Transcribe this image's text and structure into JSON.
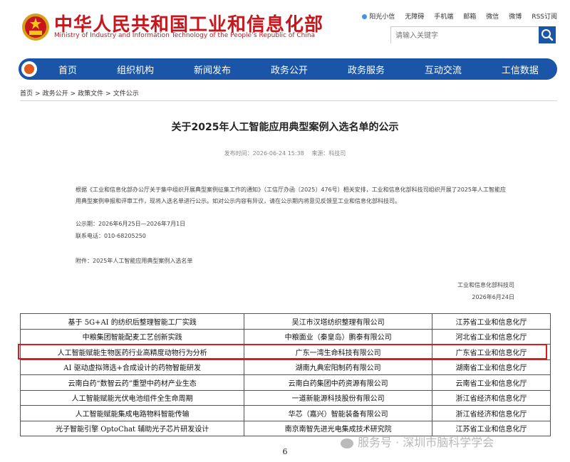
{
  "header": {
    "title": "中华人民共和国工业和信息化部",
    "subtitle": "Ministry of Industry and Information Technology of the People’s Republic of China",
    "top_links": [
      "阳光小信",
      "无障碍",
      "手机端",
      "邮箱",
      "微信",
      "微博",
      "RSS订阅"
    ],
    "search_placeholder": "请输入关键字"
  },
  "nav": [
    "首页",
    "组织机构",
    "新闻发布",
    "政务公开",
    "政务服务",
    "互动交流",
    "工信数据"
  ],
  "breadcrumb": [
    "首页",
    "政务公开",
    "政策文件",
    "文件公示"
  ],
  "article": {
    "title": "关于2025年人工智能应用典型案例入选名单的公示",
    "publish_time": "发布时间：2026-06-24 15:38",
    "source": "来源：科技司",
    "paragraph": "根据《工业和信息化部办公厅关于集中组织开展典型案例征集工作的通知》（工信厅办函〔2025〕476号）相关安排，工业和信息化部科技司组织开展了2025年人工智能应用典型案例申报和评审工作，现将入选名单进行公示。如对公示内容有异议，请在公示期内将意见反馈至工业和信息化部科技司。",
    "period": "公示期：2026年6月25日—2026年7月1日",
    "phone": "联系电话：010-68205250",
    "attachment": "附件：2025年人工智能应用典型案例入选名单",
    "signature": "工业和信息化部科技司",
    "date": "2026年6月24日"
  },
  "table_rows": [
    [
      "基于 5G+AI 的纺织后整理智能工厂实践",
      "吴江市汉塔纺织整理有限公司",
      "江苏省工业和信息化厅"
    ],
    [
      "中粮集团智能配麦工艺创新实践",
      "中粮面业（秦皇岛）鹏泰有限公司",
      "河北省工业和信息化厅"
    ],
    [
      "人工智能赋能生物医药行业高精度动物行为分析",
      "广东一湾生命科技有限公司",
      "广东省工业和信息化厅"
    ],
    [
      "AI 驱动虚拟筛选+合成设计的药物智能研发",
      "湖南九典宏阳制药有限公司",
      "湖南省工业和信息化厅"
    ],
    [
      "云南白药“数智云药”重塑中药材产业生态",
      "云南白药集团中药资源有限公司",
      "云南省工业和信息化厅"
    ],
    [
      "人工智能赋能光伏电池组件全生命周期",
      "一道新能源科技股份有限公司",
      "浙江省经济和信息化厅"
    ],
    [
      "人工智能赋能集成电路物料智能传输",
      "华芯（嘉兴）智能装备有限公司",
      "浙江省经济和信息化厅"
    ],
    [
      "光子智能引擎 OptoChat 辅助光子芯片研发设计",
      "南京南智先进光电集成技术研究院",
      "江苏省工业和信息化厅"
    ]
  ],
  "page_number": "6",
  "watermark": "服务号 · 深圳市脑科学学会",
  "colors": {
    "brand_red": "#c8161d",
    "nav_blue": "#1b55a7",
    "highlight": "#e0191f"
  }
}
